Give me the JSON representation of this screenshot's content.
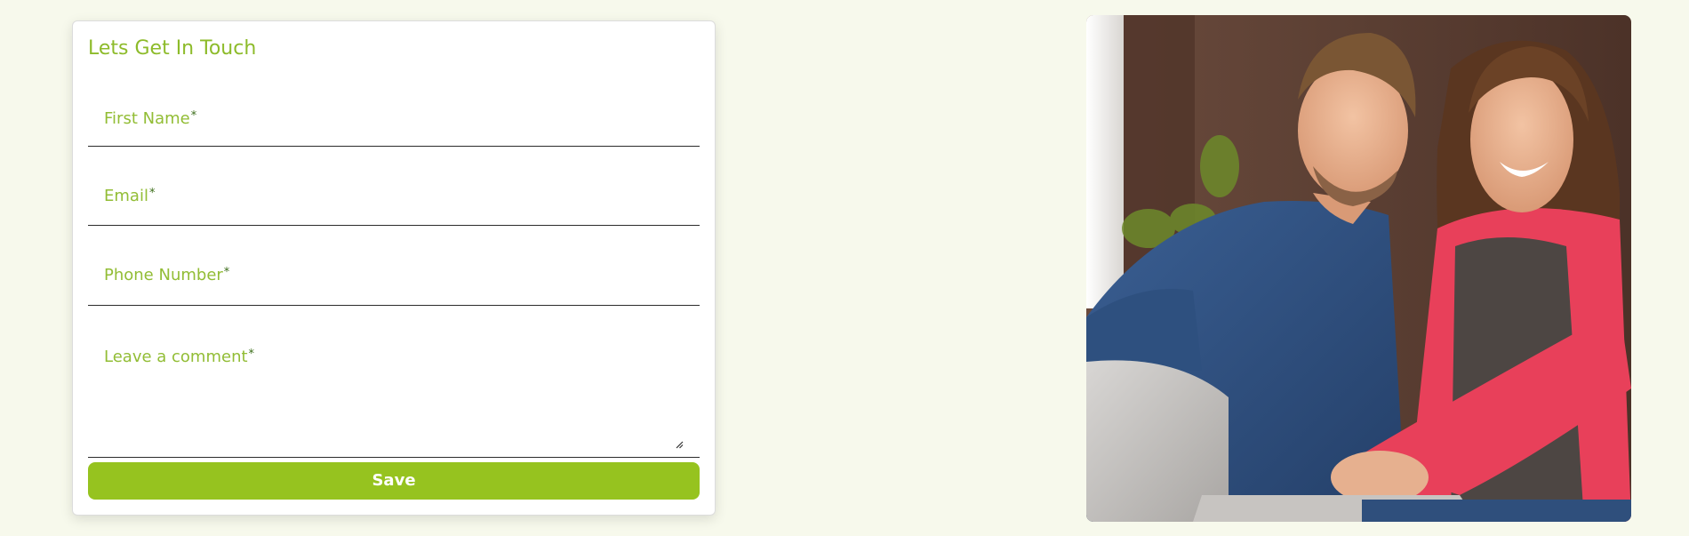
{
  "form": {
    "title": "Lets Get In Touch",
    "fields": [
      {
        "label": "First Name",
        "required_mark": "*"
      },
      {
        "label": "Email",
        "required_mark": "*"
      },
      {
        "label": "Phone Number",
        "required_mark": "*"
      },
      {
        "label": "Leave a comment",
        "required_mark": "*"
      }
    ],
    "submit_label": "Save"
  },
  "colors": {
    "page_background": "#f7f9ec",
    "accent": "#96c31f",
    "label_text": "#92bd35"
  }
}
